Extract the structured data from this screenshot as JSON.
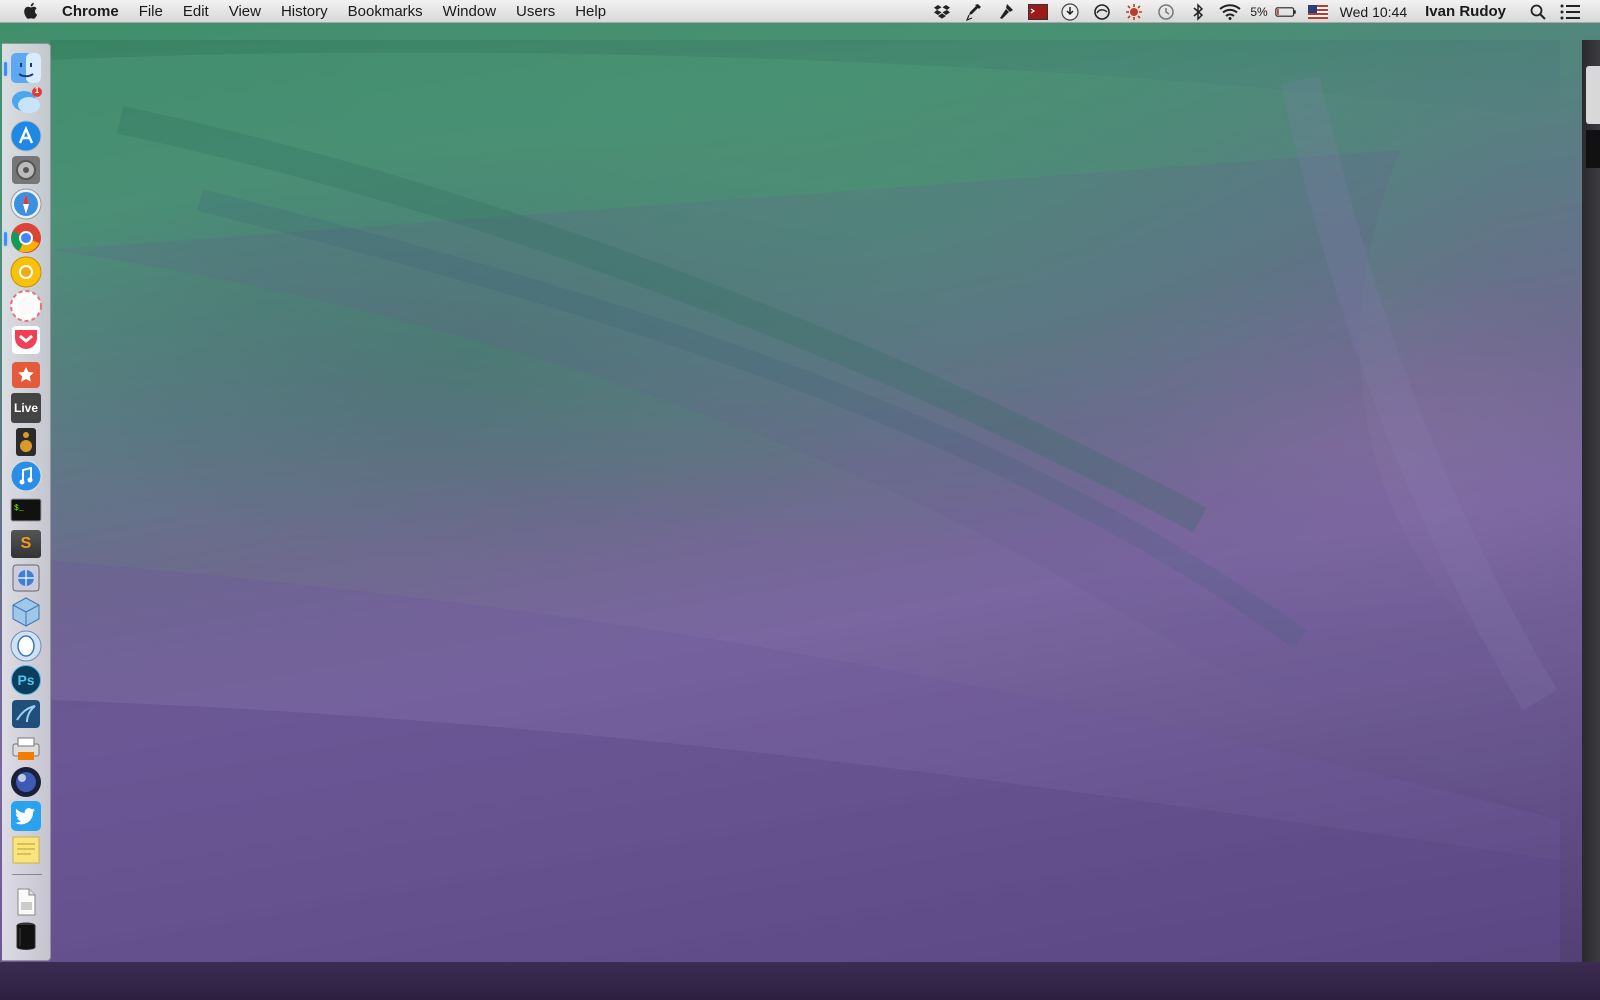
{
  "menubar": {
    "app_name": "Chrome",
    "menus": [
      "File",
      "Edit",
      "View",
      "History",
      "Bookmarks",
      "Window",
      "Users",
      "Help"
    ],
    "status": {
      "icons": [
        "dropbox-icon",
        "eyedropper-icon",
        "pen-icon",
        "terminal-icon",
        "download-icon",
        "sync-icon",
        "brightness-icon",
        "time-machine-icon",
        "bluetooth-icon",
        "wifi-icon"
      ],
      "battery_percent": "5%",
      "input_source": "us-flag-icon",
      "clock": "Wed 10:44",
      "user_name": "Ivan Rudoy"
    }
  },
  "dock": {
    "items": [
      {
        "name": "finder",
        "running": true,
        "badge": ""
      },
      {
        "name": "messages",
        "running": false,
        "badge": "1"
      },
      {
        "name": "app-store",
        "running": false,
        "badge": ""
      },
      {
        "name": "system-preferences",
        "running": false,
        "badge": ""
      },
      {
        "name": "safari",
        "running": false,
        "badge": ""
      },
      {
        "name": "chrome",
        "running": true,
        "badge": ""
      },
      {
        "name": "chrome-canary",
        "running": false,
        "badge": ""
      },
      {
        "name": "chromium",
        "running": false,
        "badge": ""
      },
      {
        "name": "pocket",
        "running": false,
        "badge": ""
      },
      {
        "name": "wunderlist",
        "running": false,
        "badge": ""
      },
      {
        "name": "ableton-live",
        "running": false,
        "badge": "",
        "label": "Live"
      },
      {
        "name": "speaker-app",
        "running": false,
        "badge": ""
      },
      {
        "name": "itunes",
        "running": false,
        "badge": ""
      },
      {
        "name": "terminal",
        "running": false,
        "badge": ""
      },
      {
        "name": "sublime-text",
        "running": false,
        "badge": "",
        "label": "S"
      },
      {
        "name": "network-utility",
        "running": false,
        "badge": ""
      },
      {
        "name": "virtualbox",
        "running": false,
        "badge": ""
      },
      {
        "name": "sequel-pro",
        "running": false,
        "badge": ""
      },
      {
        "name": "photoshop",
        "running": false,
        "badge": "",
        "label": "Ps"
      },
      {
        "name": "mysql-workbench",
        "running": false,
        "badge": ""
      },
      {
        "name": "printer-app",
        "running": false,
        "badge": ""
      },
      {
        "name": "cinema-4d",
        "running": false,
        "badge": ""
      },
      {
        "name": "twitter",
        "running": false,
        "badge": ""
      },
      {
        "name": "stickies",
        "running": false,
        "badge": ""
      }
    ],
    "stack_items": [
      {
        "name": "documents-stack"
      },
      {
        "name": "trash"
      }
    ]
  },
  "colors": {
    "menubar_bg": "#e6e6e6",
    "dock_indicator": "#3b8dff",
    "wallpaper_green": "#3f8f6a",
    "wallpaper_purple": "#6f5b94"
  }
}
